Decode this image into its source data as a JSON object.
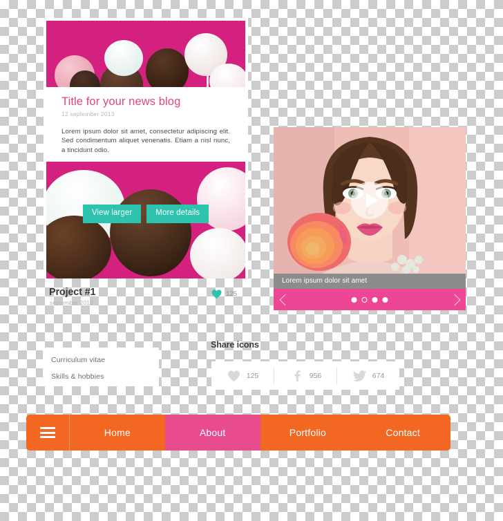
{
  "blog_card": {
    "image_alt": "cake-pops-photo",
    "title": "Title for your news blog",
    "date": "12 september 2013",
    "body": "Lorem ipsum dolor sit amet, consectetur adipiscing elit. Sed condimentum aliquet venenatis. Etiam a nisl nunc, a tincidunt odio.",
    "buttons": [
      {
        "label": "View larger",
        "name": "view-larger-button"
      },
      {
        "label": "More details",
        "name": "more-details-button"
      }
    ],
    "accent_color": "#2ec3ae",
    "title_color": "#e0457f"
  },
  "project": {
    "title": "Project #1",
    "date": "september 2012",
    "like_icon": "heart-icon",
    "like_count": "125",
    "heart_color": "#2ec3ae"
  },
  "menu": {
    "items": [
      {
        "label": "Curriculum vitae",
        "name": "menu-item-curriculum-vitae"
      },
      {
        "label": "Skills & hobbies",
        "name": "menu-item-skills-hobbies"
      }
    ]
  },
  "media_card": {
    "image_alt": "woman-with-rose-portrait",
    "play_icon": "play-icon",
    "caption": "Lorem ipsum dolor sit amet",
    "prev_icon": "chevron-left-icon",
    "next_icon": "chevron-right-icon",
    "dots_total": 4,
    "dot_active_index": 1,
    "slider_color": "#ec4694"
  },
  "share": {
    "heading": "Share icons",
    "items": [
      {
        "icon": "heart-icon",
        "count": "125",
        "name": "share-likes"
      },
      {
        "icon": "facebook-icon",
        "count": "956",
        "name": "share-facebook"
      },
      {
        "icon": "twitter-icon",
        "count": "674",
        "name": "share-twitter"
      }
    ]
  },
  "navbar": {
    "menu_icon": "hamburger-icon",
    "bg_color": "#f26722",
    "active_color": "#e84c8f",
    "items": [
      {
        "label": "Home",
        "name": "nav-item-home",
        "active": false
      },
      {
        "label": "About",
        "name": "nav-item-about",
        "active": true
      },
      {
        "label": "Portfolio",
        "name": "nav-item-portfolio",
        "active": false
      },
      {
        "label": "Contact",
        "name": "nav-item-contact",
        "active": false
      }
    ]
  }
}
